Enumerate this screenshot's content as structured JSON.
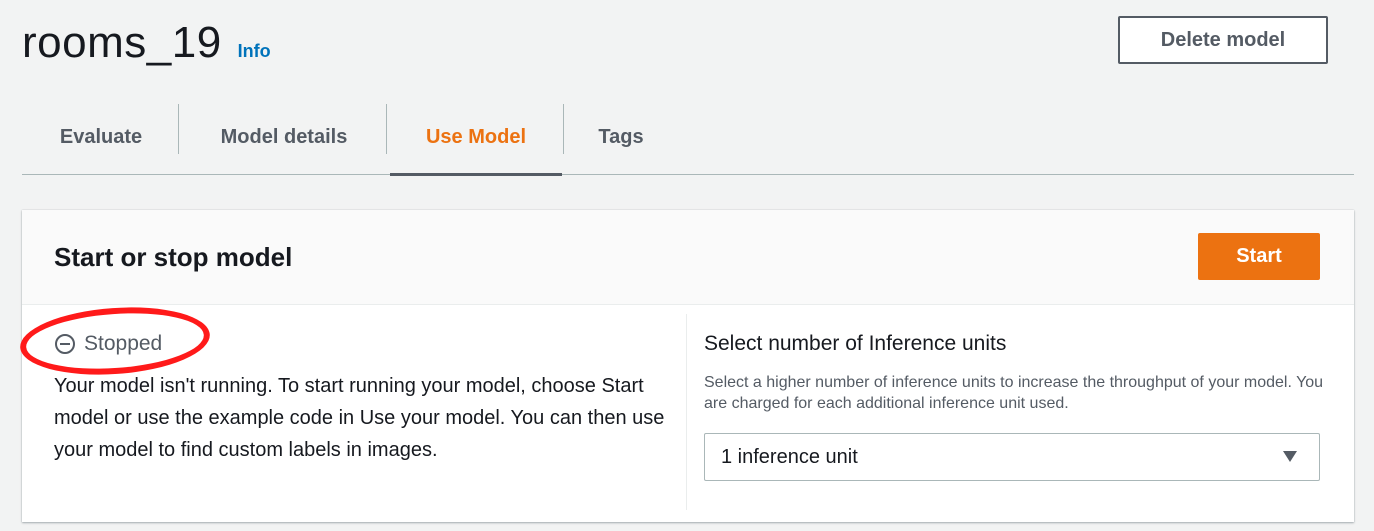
{
  "header": {
    "title": "rooms_19",
    "info": "Info",
    "delete_label": "Delete model"
  },
  "tabs": [
    {
      "label": "Evaluate",
      "active": false
    },
    {
      "label": "Model details",
      "active": false
    },
    {
      "label": "Use Model",
      "active": true
    },
    {
      "label": "Tags",
      "active": false
    }
  ],
  "panel": {
    "title": "Start or stop model",
    "start_label": "Start",
    "status": {
      "icon": "stopped-circle-icon",
      "label": "Stopped",
      "description": "Your model isn't running. To start running your model, choose Start model or use the example code in Use your model. You can then use your model to find custom labels in images."
    },
    "inference": {
      "label": "Select number of Inference units",
      "description": "Select a higher number of inference units to increase the throughput of your model. You are charged for each additional inference unit used.",
      "selected": "1 inference unit"
    }
  },
  "colors": {
    "accent": "#ec7211",
    "link": "#0073bb",
    "annotation": "#ff1a1a"
  }
}
